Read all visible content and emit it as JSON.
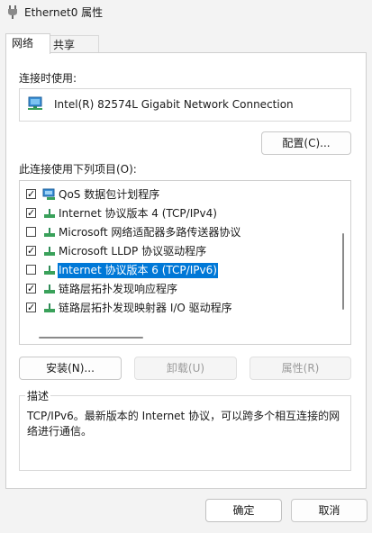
{
  "window": {
    "title": "Ethernet0 属性"
  },
  "tabs": [
    {
      "label": "网络",
      "active": true
    },
    {
      "label": "共享",
      "active": false
    }
  ],
  "connect_using": {
    "label": "连接时使用:",
    "adapter_name": "Intel(R) 82574L Gigabit Network Connection",
    "configure_button": "配置(C)..."
  },
  "items_section": {
    "label": "此连接使用下列项目(O):",
    "items": [
      {
        "label": "QoS 数据包计划程序",
        "checked": true,
        "icon": "qos-scheduler-icon",
        "selected": false
      },
      {
        "label": "Internet 协议版本 4 (TCP/IPv4)",
        "checked": true,
        "icon": "network-protocol-icon",
        "selected": false
      },
      {
        "label": "Microsoft 网络适配器多路传送器协议",
        "checked": false,
        "icon": "network-protocol-icon",
        "selected": false
      },
      {
        "label": "Microsoft LLDP 协议驱动程序",
        "checked": true,
        "icon": "network-protocol-icon",
        "selected": false
      },
      {
        "label": "Internet 协议版本 6 (TCP/IPv6)",
        "checked": false,
        "icon": "network-protocol-icon",
        "selected": true
      },
      {
        "label": "链路层拓扑发现响应程序",
        "checked": true,
        "icon": "network-protocol-icon",
        "selected": false
      },
      {
        "label": "链路层拓扑发现映射器 I/O 驱动程序",
        "checked": true,
        "icon": "network-protocol-icon",
        "selected": false
      }
    ]
  },
  "item_buttons": {
    "install": "安装(N)...",
    "uninstall": "卸载(U)",
    "properties": "属性(R)"
  },
  "description": {
    "title": "描述",
    "text": "TCP/IPv6。最新版本的 Internet 协议，可以跨多个相互连接的网络进行通信。"
  },
  "dialog_buttons": {
    "ok": "确定",
    "cancel": "取消"
  },
  "colors": {
    "selection": "#0078d7",
    "window_bg": "#f3f3f3"
  }
}
